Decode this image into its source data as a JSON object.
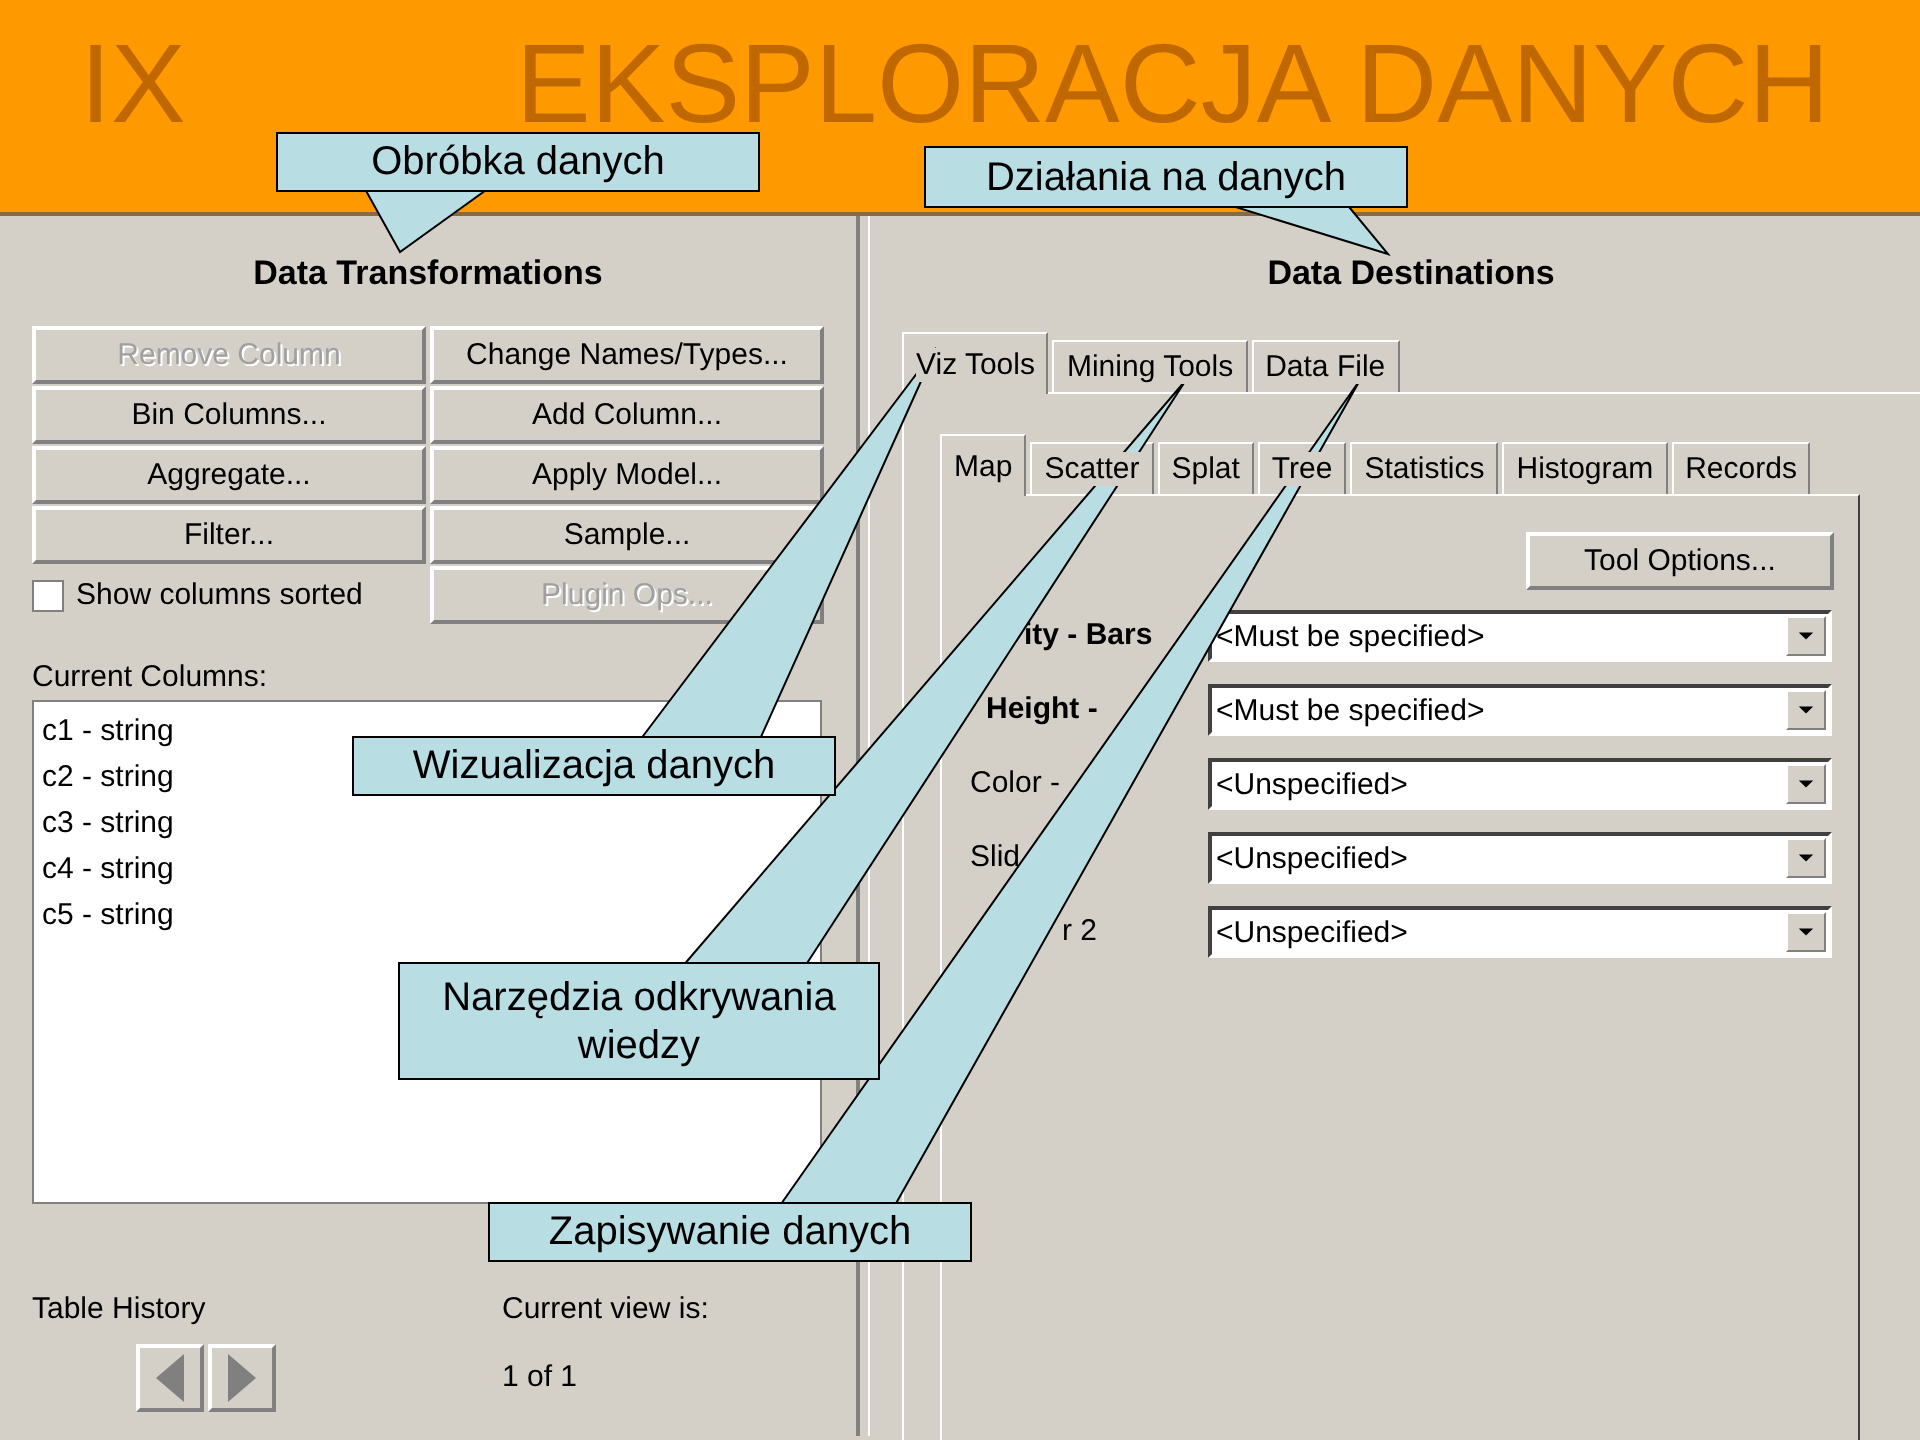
{
  "slide": {
    "number": "IX",
    "title": "EKSPLORACJA DANYCH"
  },
  "data_transformations": {
    "title": "Data Transformations",
    "controls": [
      {
        "kind": "button",
        "label": "Remove Column",
        "disabled": true
      },
      {
        "kind": "button",
        "label": "Change Names/Types...",
        "disabled": false
      },
      {
        "kind": "button",
        "label": "Bin Columns...",
        "disabled": false
      },
      {
        "kind": "button",
        "label": "Add Column...",
        "disabled": false
      },
      {
        "kind": "button",
        "label": "Aggregate...",
        "disabled": false
      },
      {
        "kind": "button",
        "label": "Apply Model...",
        "disabled": false
      },
      {
        "kind": "button",
        "label": "Filter...",
        "disabled": false
      },
      {
        "kind": "button",
        "label": "Sample...",
        "disabled": false
      },
      {
        "kind": "checkbox",
        "label": "Show columns sorted",
        "checked": false
      },
      {
        "kind": "button",
        "label": "Plugin Ops...",
        "disabled": true
      }
    ],
    "columns_label": "Current Columns:",
    "columns": [
      "c1 - string",
      "c2 - string",
      "c3 - string",
      "c4 - string",
      "c5 - string"
    ],
    "table_history_label": "Table History",
    "current_view_label": "Current view is:",
    "current_view": "1 of 1"
  },
  "data_destinations": {
    "title": "Data Destinations",
    "tabs": [
      {
        "label": "Viz Tools",
        "selected": true
      },
      {
        "label": "Mining Tools",
        "selected": false
      },
      {
        "label": "Data File",
        "selected": false
      }
    ],
    "tool_tabs": [
      {
        "label": "Map",
        "selected": true
      },
      {
        "label": "Scatter",
        "selected": false
      },
      {
        "label": "Splat",
        "selected": false
      },
      {
        "label": "Tree",
        "selected": false
      },
      {
        "label": "Statistics",
        "selected": false
      },
      {
        "label": "Histogram",
        "selected": false
      },
      {
        "label": "Records",
        "selected": false
      }
    ],
    "tool_options": "Tool Options...",
    "fields": [
      {
        "label": "ity - Bars",
        "required": true,
        "value": "<Must be specified>"
      },
      {
        "label": "Height -",
        "required": true,
        "value": "<Must be specified>"
      },
      {
        "label": "Color -",
        "required": false,
        "value": "<Unspecified>"
      },
      {
        "label": "Slid",
        "required": false,
        "value": "<Unspecified>"
      },
      {
        "label": "r 2",
        "required": false,
        "value": "<Unspecified>"
      }
    ]
  },
  "callouts": [
    {
      "text": "Obróbka danych"
    },
    {
      "text": "Działania na danych"
    },
    {
      "text": "Wizualizacja danych"
    },
    {
      "text": "Narzędzia odkrywania wiedzy"
    },
    {
      "text": "Zapisywanie danych"
    }
  ]
}
